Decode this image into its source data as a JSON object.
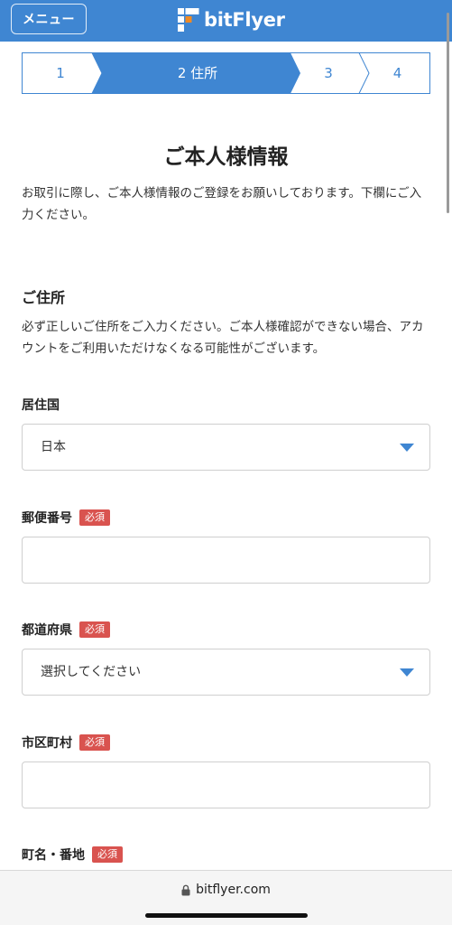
{
  "header": {
    "menu_label": "メニュー",
    "brand_name": "bitFlyer",
    "brand_color": "#3f86d2"
  },
  "stepper": {
    "steps": [
      {
        "label": "1",
        "active": false
      },
      {
        "label": "2 住所",
        "active": true
      },
      {
        "label": "3",
        "active": false
      },
      {
        "label": "4",
        "active": false
      }
    ]
  },
  "page": {
    "title": "ご本人様情報",
    "intro": "お取引に際し、ご本人様情報のご登録をお願いしております。下欄にご入力ください。"
  },
  "address_section": {
    "title": "ご住所",
    "description": "必ず正しいご住所をご入力ください。ご本人様確認ができない場合、アカウントをご利用いただけなくなる可能性がございます。"
  },
  "fields": {
    "country": {
      "label": "居住国",
      "value": "日本"
    },
    "postal_code": {
      "label": "郵便番号",
      "required": "必須",
      "value": ""
    },
    "prefecture": {
      "label": "都道府県",
      "required": "必須",
      "value": "選択してください"
    },
    "city": {
      "label": "市区町村",
      "required": "必須",
      "value": ""
    },
    "street": {
      "label": "町名・番地",
      "required": "必須"
    }
  },
  "browser": {
    "url": "bitflyer.com"
  }
}
